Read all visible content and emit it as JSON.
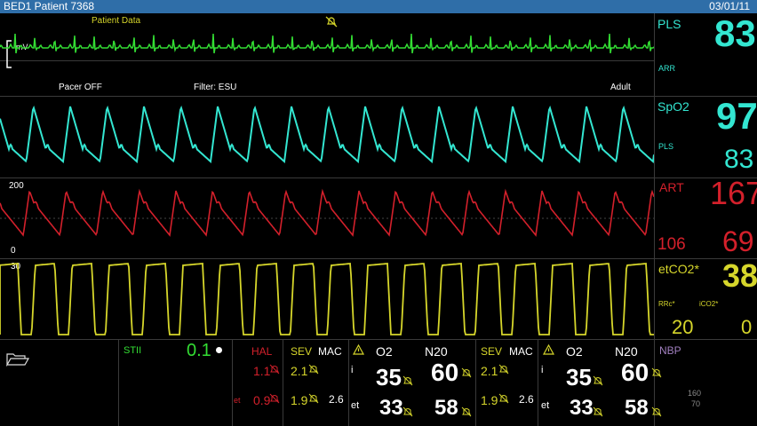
{
  "header": {
    "title": "BED1 Patient 7368",
    "date": "03/01/11"
  },
  "ecg": {
    "label": "Patient Data",
    "unit": "mV",
    "pacer": "Pacer OFF",
    "filter": "Filter: ESU",
    "mode": "Adult"
  },
  "art_wave": {
    "scale_top": "200",
    "scale_bottom": "0"
  },
  "co2_wave": {
    "scale_top": "30"
  },
  "vitals": {
    "pls_label": "PLS",
    "pls_value": "83",
    "arr_label": "ARR",
    "spo2_label": "SpO2",
    "spo2_value": "97",
    "spo2_pls_label": "PLS",
    "spo2_pls_value": "83",
    "art_label": "ART",
    "art_value": "167",
    "art_low": "106",
    "art_mean": "69",
    "etco2_label": "etCO2*",
    "etco2_value": "38",
    "rrc_label": "RRc*",
    "rrc_value": "20",
    "ico2_label": "iCO2*",
    "ico2_value": "0"
  },
  "bottom": {
    "st_label": "STII",
    "st_value": "0.1",
    "hal_label": "HAL",
    "hal_i": "1.1",
    "et_label": "et",
    "hal_et": "0.9",
    "sev_label": "SEV",
    "mac_label": "MAC",
    "sev_i": "2.1",
    "sev_et": "1.9",
    "mac_value": "2.6",
    "o2_label": "O2",
    "n2o_label": "N20",
    "i_label": "i",
    "o2_i": "35",
    "n2o_i": "60",
    "o2_et": "33",
    "n2o_et": "58",
    "sev2_label": "SEV",
    "mac2_label": "MAC",
    "sev2_i": "2.1",
    "sev2_et": "1.9",
    "mac2_value": "2.6",
    "o2b_label": "O2",
    "n2ob_label": "N20",
    "o2b_i": "35",
    "n2ob_i": "60",
    "o2b_et": "33",
    "n2ob_et": "58",
    "nbp_label": "NBP",
    "nbp_high": "160",
    "nbp_low": "70"
  },
  "colors": {
    "ecg": "#33dd33",
    "pleth": "#33e6d1",
    "art": "#d3202b",
    "co2": "#d6d62b",
    "titlebar": "#2f6ea8"
  },
  "icons": [
    "alarm-off-icon",
    "folder-icon",
    "warning-icon",
    "bell-mute-icon",
    "dot-icon"
  ]
}
